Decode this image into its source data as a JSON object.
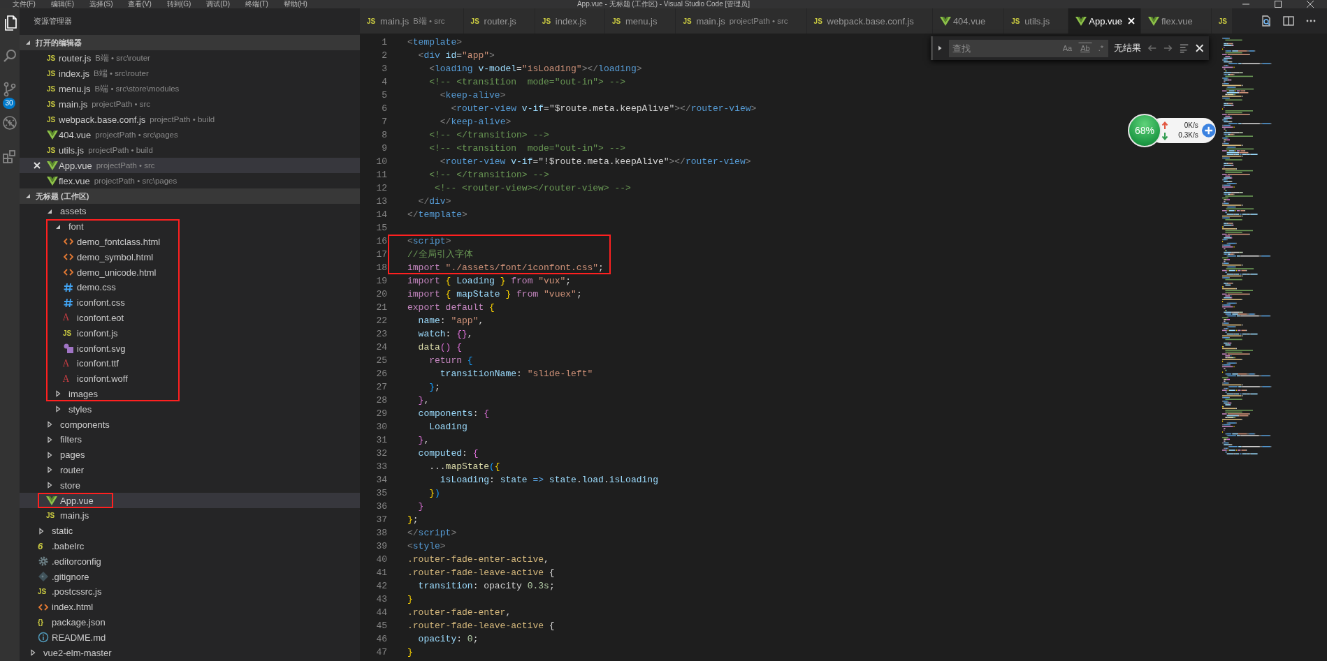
{
  "title_bar": {
    "menu": [
      "文件(F)",
      "编辑(E)",
      "选择(S)",
      "查看(V)",
      "转到(G)",
      "调试(D)",
      "终端(T)",
      "帮助(H)"
    ],
    "title": "App.vue - 无标题 (工作区) - Visual Studio Code [管理员]"
  },
  "activity_bar": {
    "items": [
      {
        "kind": "files",
        "selected": true
      },
      {
        "kind": "search",
        "selected": false
      },
      {
        "kind": "source-control",
        "selected": false,
        "badge": "30"
      },
      {
        "kind": "debug",
        "selected": false
      },
      {
        "kind": "extensions",
        "selected": false
      }
    ]
  },
  "sidebar": {
    "title": "资源管理器",
    "sections": [
      {
        "kind": "open-editors",
        "title": "打开的编辑器",
        "expanded": true,
        "items": [
          {
            "name": "router.js",
            "description": "B端 • src\\router",
            "kind": "js",
            "icon_text": "JS",
            "selected": false,
            "close_visible": false
          },
          {
            "name": "index.js",
            "description": "B端 • src\\router",
            "kind": "js",
            "icon_text": "JS",
            "selected": false,
            "close_visible": false
          },
          {
            "name": "menu.js",
            "description": "B端 • src\\store\\modules",
            "kind": "js",
            "icon_text": "JS",
            "selected": false,
            "close_visible": false
          },
          {
            "name": "main.js",
            "description": "projectPath • src",
            "kind": "js",
            "icon_text": "JS",
            "selected": false,
            "close_visible": false
          },
          {
            "name": "webpack.base.conf.js",
            "description": "projectPath • build",
            "kind": "js",
            "icon_text": "JS",
            "selected": false,
            "close_visible": false
          },
          {
            "name": "404.vue",
            "description": "projectPath • src\\pages",
            "kind": "vue",
            "selected": false,
            "close_visible": false
          },
          {
            "name": "utils.js",
            "description": "projectPath • build",
            "kind": "js",
            "icon_text": "JS",
            "selected": false,
            "close_visible": false
          },
          {
            "name": "App.vue",
            "description": "projectPath • src",
            "kind": "vue",
            "selected": true,
            "close_visible": true
          },
          {
            "name": "flex.vue",
            "description": "projectPath • src\\pages",
            "kind": "vue",
            "selected": false,
            "close_visible": false
          }
        ]
      },
      {
        "kind": "tree",
        "title": "无标题 (工作区)",
        "expanded": true,
        "items": [
          {
            "children": [
              {
                "children": [
                  {
                    "name": "assets",
                    "kind": "folder",
                    "expanded": true,
                    "selected": false,
                    "boxed": false,
                    "children": [
                      {
                        "name": "font",
                        "kind": "folder",
                        "expanded": true,
                        "selected": false,
                        "boxed": true,
                        "children": [
                          {
                            "name": "demo_fontclass.html",
                            "kind": "html",
                            "selected": false,
                            "boxed": true
                          },
                          {
                            "name": "demo_symbol.html",
                            "kind": "html",
                            "selected": false,
                            "boxed": true
                          },
                          {
                            "name": "demo_unicode.html",
                            "kind": "html",
                            "selected": false,
                            "boxed": true
                          },
                          {
                            "name": "demo.css",
                            "kind": "css",
                            "selected": false,
                            "boxed": true
                          },
                          {
                            "name": "iconfont.css",
                            "kind": "css",
                            "selected": false,
                            "boxed": true
                          },
                          {
                            "name": "iconfont.eot",
                            "kind": "font",
                            "icon_text": "A",
                            "selected": false,
                            "boxed": true
                          },
                          {
                            "name": "iconfont.js",
                            "kind": "js",
                            "icon_text": "JS",
                            "selected": false,
                            "boxed": true
                          },
                          {
                            "name": "iconfont.svg",
                            "kind": "svg",
                            "selected": false,
                            "boxed": true
                          },
                          {
                            "name": "iconfont.ttf",
                            "kind": "font",
                            "icon_text": "A",
                            "selected": false,
                            "boxed": true
                          },
                          {
                            "name": "iconfont.woff",
                            "kind": "font",
                            "icon_text": "A",
                            "selected": false,
                            "boxed": true
                          }
                        ]
                      },
                      {
                        "name": "images",
                        "kind": "folder",
                        "expanded": false,
                        "selected": false,
                        "boxed": true
                      },
                      {
                        "name": "styles",
                        "kind": "folder",
                        "expanded": false,
                        "selected": false,
                        "boxed": false
                      }
                    ]
                  },
                  {
                    "name": "components",
                    "kind": "folder",
                    "expanded": false,
                    "selected": false,
                    "boxed": false
                  },
                  {
                    "name": "filters",
                    "kind": "folder",
                    "expanded": false,
                    "selected": false,
                    "boxed": false
                  },
                  {
                    "name": "pages",
                    "kind": "folder",
                    "expanded": false,
                    "selected": false,
                    "boxed": false
                  },
                  {
                    "name": "router",
                    "kind": "folder",
                    "expanded": false,
                    "selected": false,
                    "boxed": false
                  },
                  {
                    "name": "store",
                    "kind": "folder",
                    "expanded": false,
                    "selected": false,
                    "boxed": false
                  },
                  {
                    "name": "App.vue",
                    "kind": "vue",
                    "selected": true,
                    "boxed": true
                  },
                  {
                    "name": "main.js",
                    "kind": "js",
                    "icon_text": "JS",
                    "selected": false,
                    "boxed": false
                  }
                ]
              },
              {
                "name": "static",
                "kind": "folder",
                "expanded": false,
                "selected": false,
                "boxed": false
              },
              {
                "name": ".babelrc",
                "kind": "babel",
                "icon_text": "6",
                "selected": false,
                "boxed": false
              },
              {
                "name": ".editorconfig",
                "kind": "config",
                "selected": false,
                "boxed": false
              },
              {
                "name": ".gitignore",
                "kind": "git",
                "selected": false,
                "boxed": false
              },
              {
                "name": ".postcssrc.js",
                "kind": "js",
                "icon_text": "JS",
                "selected": false,
                "boxed": false
              },
              {
                "name": "index.html",
                "kind": "html",
                "selected": false,
                "boxed": false
              },
              {
                "name": "package.json",
                "kind": "json",
                "icon_text": "{}",
                "selected": false,
                "boxed": false
              },
              {
                "name": "README.md",
                "kind": "info",
                "selected": false,
                "boxed": false
              }
            ]
          },
          {
            "name": "vue2-elm-master",
            "kind": "folder",
            "expanded": false,
            "selected": false,
            "boxed": false
          }
        ]
      }
    ]
  },
  "tabs": [
    {
      "label": "main.js",
      "description": "B端 • src",
      "kind": "js",
      "icon_text": "JS",
      "selected": false
    },
    {
      "label": "router.js",
      "kind": "js",
      "icon_text": "JS",
      "selected": false
    },
    {
      "label": "index.js",
      "kind": "js",
      "icon_text": "JS",
      "selected": false
    },
    {
      "label": "menu.js",
      "kind": "js",
      "icon_text": "JS",
      "selected": false
    },
    {
      "label": "main.js",
      "description": "projectPath • src",
      "kind": "js",
      "icon_text": "JS",
      "selected": false
    },
    {
      "label": "webpack.base.conf.js",
      "kind": "js",
      "icon_text": "JS",
      "selected": false
    },
    {
      "label": "404.vue",
      "kind": "vue",
      "selected": false
    },
    {
      "label": "utils.js",
      "kind": "js",
      "icon_text": "JS",
      "selected": false
    },
    {
      "label": "App.vue",
      "kind": "vue",
      "selected": true
    },
    {
      "label": "flex.vue",
      "kind": "vue",
      "selected": false
    },
    {
      "kind": "js",
      "icon_text": "JS",
      "selected": false
    }
  ],
  "editor": {
    "lines": [
      {
        "number": "1",
        "boxed": false,
        "tokens": [
          {
            "kind": "p",
            "text": "<"
          },
          {
            "kind": "tag",
            "text": "template"
          },
          {
            "kind": "p",
            "text": ">"
          }
        ]
      },
      {
        "number": "2",
        "boxed": false,
        "tokens": [
          {
            "kind": "p",
            "text": "  <"
          },
          {
            "kind": "tag",
            "text": "div"
          },
          {
            "kind": "attr",
            "text": " id"
          },
          {
            "kind": "op",
            "text": "="
          },
          {
            "kind": "str",
            "text": "\"app\""
          },
          {
            "kind": "p",
            "text": ">"
          }
        ]
      },
      {
        "number": "3",
        "boxed": false,
        "tokens": [
          {
            "kind": "p",
            "text": "    <"
          },
          {
            "kind": "tag",
            "text": "loading"
          },
          {
            "kind": "attr",
            "text": " v-model"
          },
          {
            "kind": "op",
            "text": "="
          },
          {
            "kind": "str",
            "text": "\"isLoading\""
          },
          {
            "kind": "p",
            "text": "></"
          },
          {
            "kind": "tag",
            "text": "loading"
          },
          {
            "kind": "p",
            "text": ">"
          }
        ]
      },
      {
        "number": "4",
        "boxed": false,
        "tokens": [
          {
            "kind": "cm",
            "text": "    <!-- <transition  mode=\"out-in\"> -->"
          }
        ]
      },
      {
        "number": "5",
        "boxed": false,
        "tokens": [
          {
            "kind": "p",
            "text": "      <"
          },
          {
            "kind": "tag",
            "text": "keep-alive"
          },
          {
            "kind": "p",
            "text": ">"
          }
        ]
      },
      {
        "number": "6",
        "boxed": false,
        "tokens": [
          {
            "kind": "p",
            "text": "        <"
          },
          {
            "kind": "tag",
            "text": "router-view"
          },
          {
            "kind": "attr",
            "text": " v-if"
          },
          {
            "kind": "op",
            "text": "="
          },
          {
            "kind": "plain",
            "text": "\"$route.meta.keepAlive\""
          },
          {
            "kind": "p",
            "text": "></"
          },
          {
            "kind": "tag",
            "text": "router-view"
          },
          {
            "kind": "p",
            "text": ">"
          }
        ]
      },
      {
        "number": "7",
        "boxed": false,
        "tokens": [
          {
            "kind": "p",
            "text": "      </"
          },
          {
            "kind": "tag",
            "text": "keep-alive"
          },
          {
            "kind": "p",
            "text": ">"
          }
        ]
      },
      {
        "number": "8",
        "boxed": false,
        "tokens": [
          {
            "kind": "cm",
            "text": "    <!-- </transition> -->"
          }
        ]
      },
      {
        "number": "9",
        "boxed": false,
        "tokens": [
          {
            "kind": "cm",
            "text": "    <!-- <transition  mode=\"out-in\"> -->"
          }
        ]
      },
      {
        "number": "10",
        "boxed": false,
        "tokens": [
          {
            "kind": "p",
            "text": "      <"
          },
          {
            "kind": "tag",
            "text": "router-view"
          },
          {
            "kind": "attr",
            "text": " v-if"
          },
          {
            "kind": "op",
            "text": "="
          },
          {
            "kind": "plain",
            "text": "\"!$route.meta.keepAlive\""
          },
          {
            "kind": "p",
            "text": "></"
          },
          {
            "kind": "tag",
            "text": "router-view"
          },
          {
            "kind": "p",
            "text": ">"
          }
        ]
      },
      {
        "number": "11",
        "boxed": false,
        "tokens": [
          {
            "kind": "cm",
            "text": "    <!-- </transition> -->"
          }
        ]
      },
      {
        "number": "12",
        "boxed": false,
        "tokens": [
          {
            "kind": "cm",
            "text": "     <!-- <router-view></router-view> -->"
          }
        ]
      },
      {
        "number": "13",
        "boxed": false,
        "tokens": [
          {
            "kind": "p",
            "text": "  </"
          },
          {
            "kind": "tag",
            "text": "div"
          },
          {
            "kind": "p",
            "text": ">"
          }
        ]
      },
      {
        "number": "14",
        "boxed": false,
        "tokens": [
          {
            "kind": "p",
            "text": "</"
          },
          {
            "kind": "tag",
            "text": "template"
          },
          {
            "kind": "p",
            "text": ">"
          }
        ]
      },
      {
        "number": "15",
        "boxed": false
      },
      {
        "number": "16",
        "boxed": true,
        "tokens": [
          {
            "kind": "p",
            "text": "<"
          },
          {
            "kind": "tag",
            "text": "script"
          },
          {
            "kind": "p",
            "text": ">"
          }
        ]
      },
      {
        "number": "17",
        "boxed": true,
        "tokens": [
          {
            "kind": "cm",
            "text": "//全局引入字体"
          }
        ]
      },
      {
        "number": "18",
        "boxed": true,
        "tokens": [
          {
            "kind": "kw",
            "text": "import"
          },
          {
            "kind": "str",
            "text": " \"./assets/font/iconfont.css\""
          },
          {
            "kind": "op",
            "text": ";"
          }
        ]
      },
      {
        "number": "19",
        "boxed": false,
        "tokens": [
          {
            "kind": "kw",
            "text": "import"
          },
          {
            "kind": "b1",
            "text": " {"
          },
          {
            "kind": "var",
            "text": " Loading"
          },
          {
            "kind": "b1",
            "text": " }"
          },
          {
            "kind": "kw",
            "text": " from"
          },
          {
            "kind": "str",
            "text": " \"vux\""
          },
          {
            "kind": "op",
            "text": ";"
          }
        ]
      },
      {
        "number": "20",
        "boxed": false,
        "tokens": [
          {
            "kind": "kw",
            "text": "import"
          },
          {
            "kind": "b1",
            "text": " {"
          },
          {
            "kind": "var",
            "text": " mapState"
          },
          {
            "kind": "b1",
            "text": " }"
          },
          {
            "kind": "kw",
            "text": " from"
          },
          {
            "kind": "str",
            "text": " \"vuex\""
          },
          {
            "kind": "op",
            "text": ";"
          }
        ]
      },
      {
        "number": "21",
        "boxed": false,
        "tokens": [
          {
            "kind": "kw",
            "text": "export default"
          },
          {
            "kind": "b1",
            "text": " {"
          }
        ]
      },
      {
        "number": "22",
        "boxed": false,
        "tokens": [
          {
            "kind": "prop",
            "text": "  name"
          },
          {
            "kind": "op",
            "text": ": "
          },
          {
            "kind": "str",
            "text": "\"app\""
          },
          {
            "kind": "op",
            "text": ","
          }
        ]
      },
      {
        "number": "23",
        "boxed": false,
        "tokens": [
          {
            "kind": "prop",
            "text": "  watch"
          },
          {
            "kind": "op",
            "text": ": "
          },
          {
            "kind": "b2",
            "text": "{}"
          },
          {
            "kind": "op",
            "text": ","
          }
        ]
      },
      {
        "number": "24",
        "boxed": false,
        "tokens": [
          {
            "kind": "func",
            "text": "  data"
          },
          {
            "kind": "b2",
            "text": "() {"
          }
        ]
      },
      {
        "number": "25",
        "boxed": false,
        "tokens": [
          {
            "kind": "kw",
            "text": "    return"
          },
          {
            "kind": "b3",
            "text": " {"
          }
        ]
      },
      {
        "number": "26",
        "boxed": false,
        "tokens": [
          {
            "kind": "prop",
            "text": "      transitionName"
          },
          {
            "kind": "op",
            "text": ": "
          },
          {
            "kind": "str",
            "text": "\"slide-left\""
          }
        ]
      },
      {
        "number": "27",
        "boxed": false,
        "tokens": [
          {
            "kind": "b3",
            "text": "    }"
          },
          {
            "kind": "op",
            "text": ";"
          }
        ]
      },
      {
        "number": "28",
        "boxed": false,
        "tokens": [
          {
            "kind": "b2",
            "text": "  }"
          },
          {
            "kind": "op",
            "text": ","
          }
        ]
      },
      {
        "number": "29",
        "boxed": false,
        "tokens": [
          {
            "kind": "prop",
            "text": "  components"
          },
          {
            "kind": "op",
            "text": ": "
          },
          {
            "kind": "b2",
            "text": "{"
          }
        ]
      },
      {
        "number": "30",
        "boxed": false,
        "tokens": [
          {
            "kind": "var",
            "text": "    Loading"
          }
        ]
      },
      {
        "number": "31",
        "boxed": false,
        "tokens": [
          {
            "kind": "b2",
            "text": "  }"
          },
          {
            "kind": "op",
            "text": ","
          }
        ]
      },
      {
        "number": "32",
        "boxed": false,
        "tokens": [
          {
            "kind": "prop",
            "text": "  computed"
          },
          {
            "kind": "op",
            "text": ": "
          },
          {
            "kind": "b2",
            "text": "{"
          }
        ]
      },
      {
        "number": "33",
        "boxed": false,
        "tokens": [
          {
            "kind": "op",
            "text": "    ..."
          },
          {
            "kind": "func",
            "text": "mapState"
          },
          {
            "kind": "b3",
            "text": "("
          },
          {
            "kind": "b1",
            "text": "{"
          }
        ]
      },
      {
        "number": "34",
        "boxed": false,
        "tokens": [
          {
            "kind": "prop",
            "text": "      isLoading"
          },
          {
            "kind": "op",
            "text": ": "
          },
          {
            "kind": "var",
            "text": "state"
          },
          {
            "kind": "arrow",
            "text": " =>"
          },
          {
            "kind": "var",
            "text": " state"
          },
          {
            "kind": "op",
            "text": "."
          },
          {
            "kind": "var",
            "text": "load"
          },
          {
            "kind": "op",
            "text": "."
          },
          {
            "kind": "var",
            "text": "isLoading"
          }
        ]
      },
      {
        "number": "35",
        "boxed": false,
        "tokens": [
          {
            "kind": "b1",
            "text": "    }"
          },
          {
            "kind": "b3",
            "text": ")"
          }
        ]
      },
      {
        "number": "36",
        "boxed": false,
        "tokens": [
          {
            "kind": "b2",
            "text": "  }"
          }
        ]
      },
      {
        "number": "37",
        "boxed": false,
        "tokens": [
          {
            "kind": "b1",
            "text": "}"
          },
          {
            "kind": "op",
            "text": ";"
          }
        ]
      },
      {
        "number": "38",
        "boxed": false,
        "tokens": [
          {
            "kind": "p",
            "text": "</"
          },
          {
            "kind": "tag",
            "text": "script"
          },
          {
            "kind": "p",
            "text": ">"
          }
        ]
      },
      {
        "number": "39",
        "boxed": false,
        "tokens": [
          {
            "kind": "p",
            "text": "<"
          },
          {
            "kind": "tag",
            "text": "style"
          },
          {
            "kind": "p",
            "text": ">"
          }
        ]
      },
      {
        "number": "40",
        "boxed": false,
        "tokens": [
          {
            "kind": "sel",
            "text": ".router-fade-enter-active"
          },
          {
            "kind": "op",
            "text": ","
          }
        ]
      },
      {
        "number": "41",
        "boxed": false,
        "tokens": [
          {
            "kind": "sel",
            "text": ".router-fade-leave-active"
          },
          {
            "kind": "op",
            "text": " {"
          }
        ]
      },
      {
        "number": "42",
        "boxed": false,
        "tokens": [
          {
            "kind": "prop",
            "text": "  transition"
          },
          {
            "kind": "op",
            "text": ": "
          },
          {
            "kind": "plain",
            "text": "opacity "
          },
          {
            "kind": "num",
            "text": "0.3s"
          },
          {
            "kind": "op",
            "text": ";"
          }
        ]
      },
      {
        "number": "43",
        "boxed": false,
        "tokens": [
          {
            "kind": "b1",
            "text": "}"
          }
        ]
      },
      {
        "number": "44",
        "boxed": false,
        "tokens": [
          {
            "kind": "sel",
            "text": ".router-fade-enter"
          },
          {
            "kind": "op",
            "text": ","
          }
        ]
      },
      {
        "number": "45",
        "boxed": false,
        "tokens": [
          {
            "kind": "sel",
            "text": ".router-fade-leave-active"
          },
          {
            "kind": "op",
            "text": " {"
          }
        ]
      },
      {
        "number": "46",
        "boxed": false,
        "tokens": [
          {
            "kind": "prop",
            "text": "  opacity"
          },
          {
            "kind": "op",
            "text": ": "
          },
          {
            "kind": "num",
            "text": "0"
          },
          {
            "kind": "op",
            "text": ";"
          }
        ]
      },
      {
        "number": "47",
        "boxed": false,
        "tokens": [
          {
            "kind": "b1",
            "text": "}"
          }
        ]
      }
    ],
    "find_widget": {
      "placeholder": "查找",
      "options": [
        {
          "label": "Aa",
          "on": false
        },
        {
          "label": "Ab",
          "on": false
        },
        {
          "label": ".*",
          "on": false
        }
      ],
      "result": "无结果"
    }
  },
  "speed_widget": {
    "percent": "68%",
    "upload": "0K/s",
    "download": "0.3K/s"
  }
}
